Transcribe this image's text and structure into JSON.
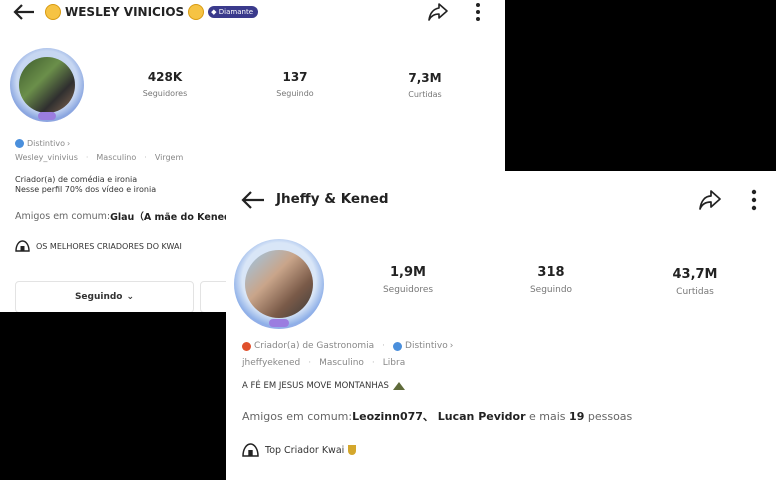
{
  "panel1": {
    "name": "WESLEY VINICIOS",
    "badge": "Diamante",
    "stats": [
      {
        "value": "428K",
        "label": "Seguidores"
      },
      {
        "value": "137",
        "label": "Seguindo"
      },
      {
        "value": "7,3M",
        "label": "Curtidas"
      }
    ],
    "distintivo": "Distintivo",
    "meta": [
      "Wesley_vinivius",
      "Masculino",
      "Virgem"
    ],
    "bio_lines": [
      "Criador(a) de comédia e ironia",
      "Nesse perfil 70% dos vídeo e ironia"
    ],
    "friends_prefix": "Amigos em comum:",
    "friends_value": "Glau（A mãe do Kened）.",
    "tag": "OS MELHORES CRIADORES DO KWAI",
    "follow_button": "Seguindo"
  },
  "panel2": {
    "name": "Jheffy & Kened",
    "stats": [
      {
        "value": "1,9M",
        "label": "Seguidores"
      },
      {
        "value": "318",
        "label": "Seguindo"
      },
      {
        "value": "43,7M",
        "label": "Curtidas"
      }
    ],
    "category": "Criador(a) de Gastronomia",
    "distintivo": "Distintivo",
    "meta": [
      "jheffyekened",
      "Masculino",
      "Libra"
    ],
    "bio": "A FÉ EM JESUS MOVE MONTANHAS",
    "friends_prefix": "Amigos em comum:",
    "friends_names": "Leozinn077、 Lucan Pevidor",
    "friends_mid": " e mais ",
    "friends_count": "19",
    "friends_suffix": " pessoas",
    "tag": "Top Criador Kwai"
  },
  "colors": {
    "diamond_badge": "#3a3a8c",
    "distintivo_icon": "#4a8fdc",
    "category_icon": "#e0502c"
  }
}
